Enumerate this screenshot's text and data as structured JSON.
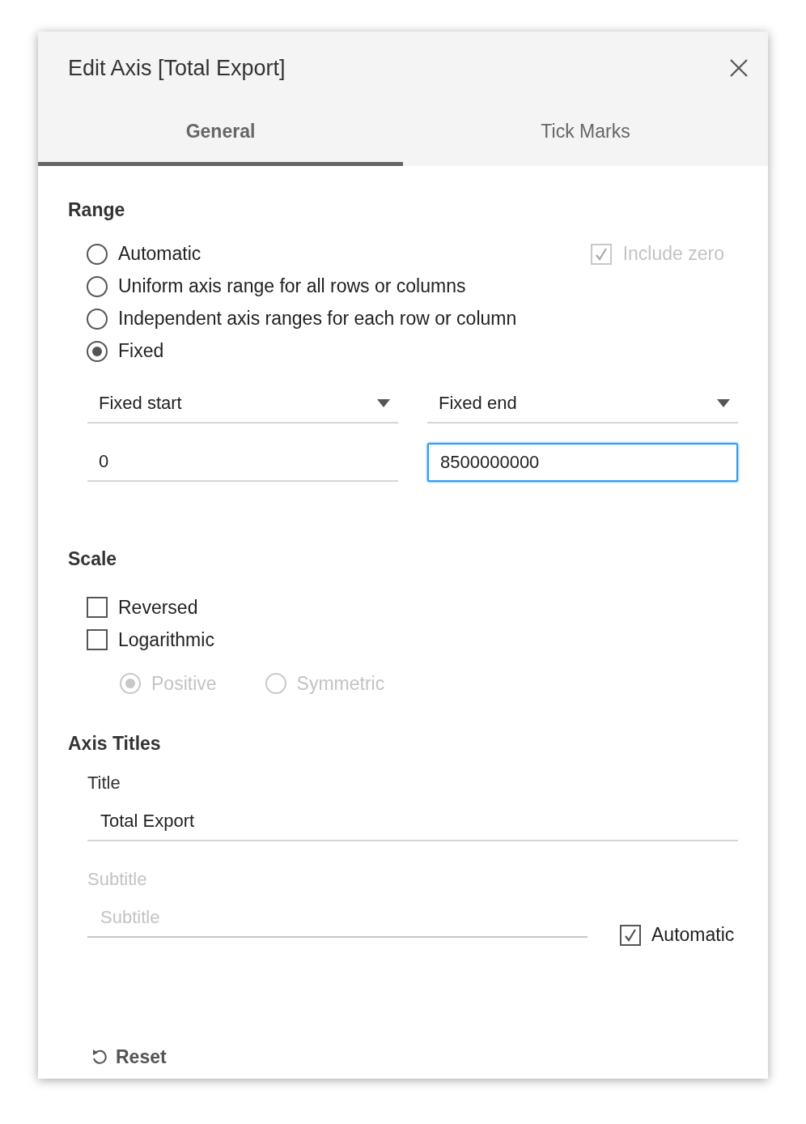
{
  "dialog": {
    "title": "Edit Axis [Total Export]"
  },
  "tabs": [
    {
      "label": "General",
      "selected": true
    },
    {
      "label": "Tick Marks",
      "selected": false
    }
  ],
  "range": {
    "heading": "Range",
    "options": [
      {
        "label": "Automatic",
        "selected": false
      },
      {
        "label": "Uniform axis range for all rows or columns",
        "selected": false
      },
      {
        "label": "Independent axis ranges for each row or column",
        "selected": false
      },
      {
        "label": "Fixed",
        "selected": true
      }
    ],
    "include_zero": {
      "label": "Include zero",
      "checked": true,
      "disabled": true
    },
    "fixed_start": {
      "mode": "Fixed start",
      "value": "0",
      "focused": false
    },
    "fixed_end": {
      "mode": "Fixed end",
      "value": "8500000000",
      "focused": true
    }
  },
  "scale": {
    "heading": "Scale",
    "checks": [
      {
        "label": "Reversed",
        "checked": false
      },
      {
        "label": "Logarithmic",
        "checked": false
      }
    ],
    "log_disabled": true,
    "log_options": [
      {
        "label": "Positive",
        "selected": true
      },
      {
        "label": "Symmetric",
        "selected": false
      }
    ]
  },
  "axis_titles": {
    "heading": "Axis Titles",
    "title_label": "Title",
    "title_value": "Total Export",
    "subtitle_label": "Subtitle",
    "subtitle_placeholder": "Subtitle",
    "subtitle_disabled": true,
    "automatic": {
      "label": "Automatic",
      "checked": true
    }
  },
  "reset": "Reset"
}
